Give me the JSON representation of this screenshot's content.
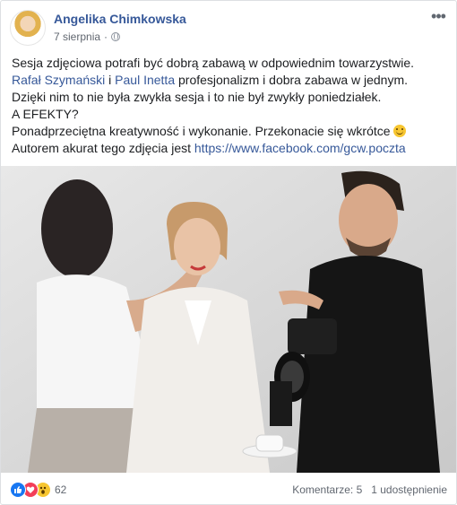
{
  "post": {
    "author": "Angelika Chimkowska",
    "date": "7 sierpnia",
    "separator": "·",
    "more": "•••",
    "text": {
      "line1": "Sesja zdjęciowa potrafi być dobrą zabawą w odpowiednim towarzystwie.",
      "mention1": "Rafał Szymański",
      "and": "i",
      "mention2": "Paul Inetta",
      "line1b": "profesjonalizm i dobra zabawa w jednym. Dzięki nim to nie była zwykła sesja i to nie był zwykły poniedziałek.",
      "line2": "A EFEKTY?",
      "line3": "Ponadprzeciętna kreatywność i wykonanie. Przekonacie się wkrótce",
      "line4": "Autorem akurat tego zdjęcia jest",
      "url": "https://www.facebook.com/gcw.poczta"
    }
  },
  "footer": {
    "reaction_count": "62",
    "comments": "Komentarze: 5",
    "shares": "1 udostępnienie"
  },
  "icons": [
    "avatar",
    "globe-icon",
    "more-icon",
    "like-icon",
    "love-icon",
    "wow-icon",
    "smile-emoji"
  ],
  "colors": {
    "link": "#365899",
    "meta": "#616770",
    "like": "#1877f2",
    "love": "#f33e58"
  }
}
